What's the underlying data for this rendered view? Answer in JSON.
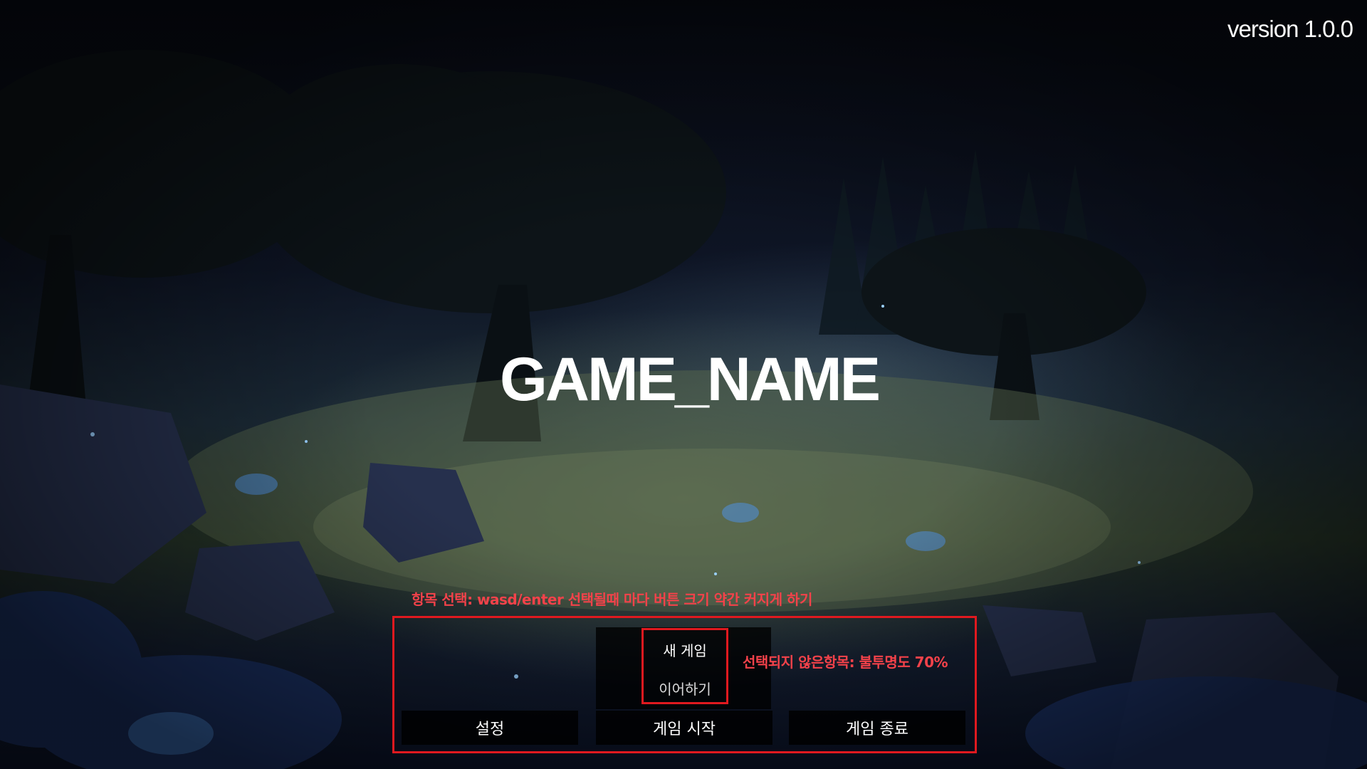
{
  "version_label": "version 1.0.0",
  "game_title": "GAME_NAME",
  "annotations": {
    "top_note": "항목 선택: wasd/enter 선택될때 마다 버튼 크기 약간 커지게 하기",
    "side_note": "선택되지 않은항목: 불투명도 70%"
  },
  "menu": {
    "submenu": {
      "new_game": "새 게임",
      "continue": "이어하기"
    },
    "buttons": {
      "settings": "설정",
      "start": "게임 시작",
      "quit": "게임 종료"
    }
  },
  "colors": {
    "annotation_red": "#e0191f",
    "note_text": "#f4424a",
    "text": "#ffffff"
  }
}
